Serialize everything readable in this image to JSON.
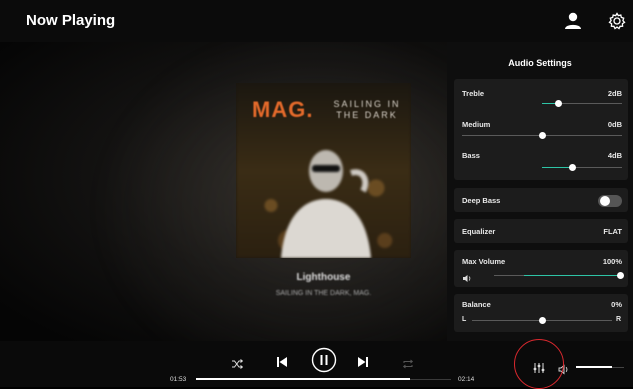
{
  "header": {
    "title": "Now Playing",
    "user_icon": "user-icon",
    "settings_icon": "gear-icon"
  },
  "album": {
    "art_title": "MAG.",
    "art_subtitle_line1": "SAILING IN",
    "art_subtitle_line2": "THE DARK",
    "track_title": "Lighthouse",
    "track_artist": "SAILING IN THE DARK, MAG."
  },
  "audio_settings": {
    "title": "Audio Settings",
    "treble": {
      "label": "Treble",
      "value": "2dB",
      "level": 0.65
    },
    "medium": {
      "label": "Medium",
      "value": "0dB",
      "level": 0.5
    },
    "bass": {
      "label": "Bass",
      "value": "4dB",
      "level": 0.75
    },
    "deep_bass": {
      "label": "Deep Bass",
      "enabled": false
    },
    "equalizer": {
      "label": "Equalizer",
      "value": "FLAT"
    },
    "max_volume": {
      "label": "Max Volume",
      "value": "100%",
      "level": 1.0,
      "icon": "speaker-icon"
    },
    "balance": {
      "label": "Balance",
      "value": "0%",
      "left_label": "L",
      "right_label": "R",
      "level": 0.5
    }
  },
  "player": {
    "elapsed": "01:53",
    "duration": "02:14",
    "progress": 0.84,
    "volume": 0.75,
    "icons": {
      "shuffle": "shuffle-icon",
      "previous": "skip-previous-icon",
      "pause": "pause-icon",
      "next": "skip-next-icon",
      "repeat": "repeat-icon",
      "equalizer": "equalizer-icon",
      "volume": "volume-icon"
    }
  },
  "colors": {
    "accent": "#2ec4a6",
    "highlight_ring": "#d9282e",
    "panel": "#0e0e0e",
    "card": "#1c1c1c"
  }
}
